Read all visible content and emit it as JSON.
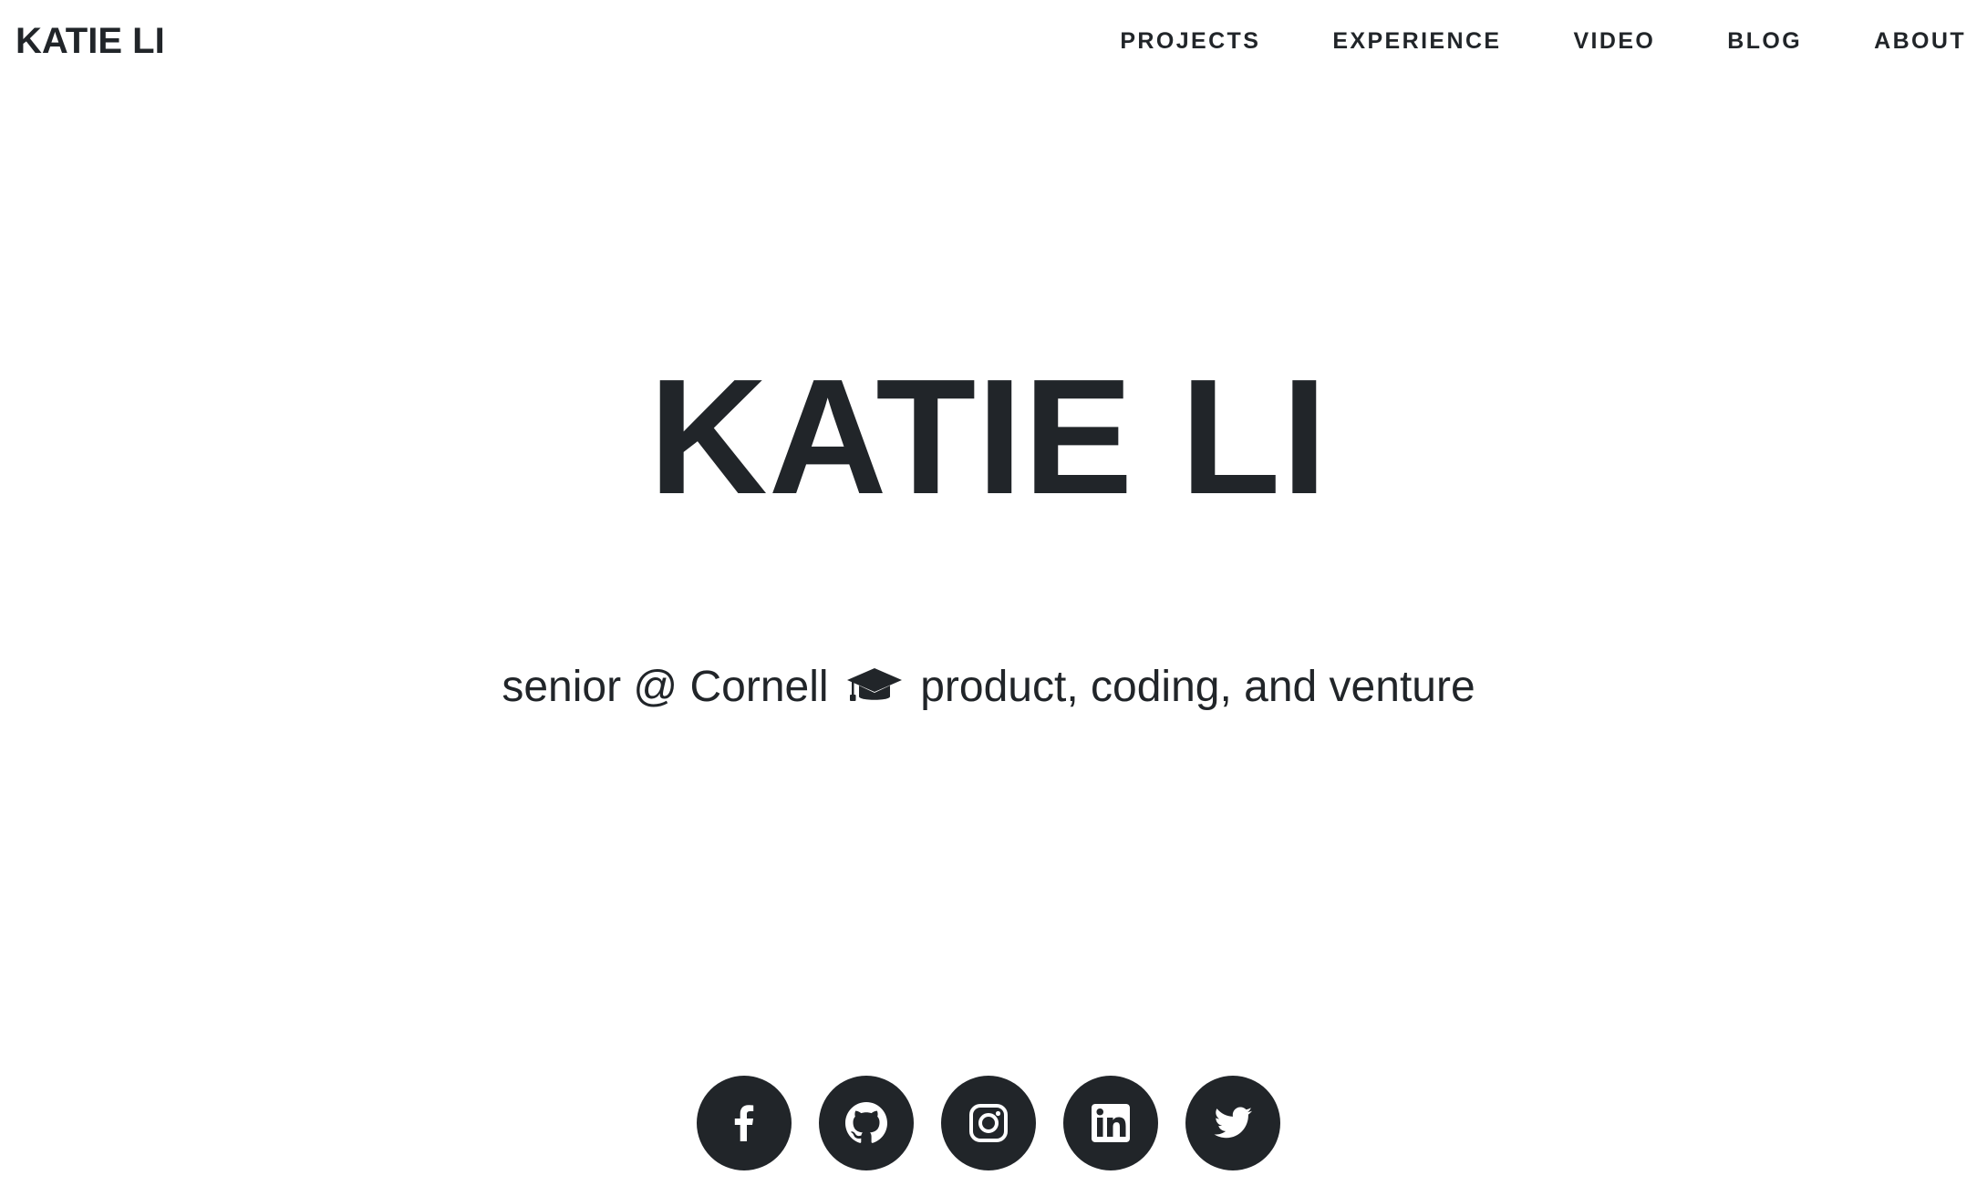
{
  "brand": "KATIE LI",
  "nav": {
    "items": [
      {
        "label": "PROJECTS"
      },
      {
        "label": "EXPERIENCE"
      },
      {
        "label": "VIDEO"
      },
      {
        "label": "BLOG"
      },
      {
        "label": "ABOUT"
      }
    ]
  },
  "hero": {
    "title": "KATIE LI",
    "subtitle_before": "senior @ Cornell",
    "subtitle_icon": "graduation-cap-icon",
    "subtitle_after": "product, coding, and venture"
  },
  "socials": [
    {
      "icon": "facebook-icon"
    },
    {
      "icon": "github-icon"
    },
    {
      "icon": "instagram-icon"
    },
    {
      "icon": "linkedin-icon"
    },
    {
      "icon": "twitter-icon"
    }
  ],
  "colors": {
    "text": "#212529",
    "background": "#ffffff",
    "icon_circle": "#212529"
  }
}
